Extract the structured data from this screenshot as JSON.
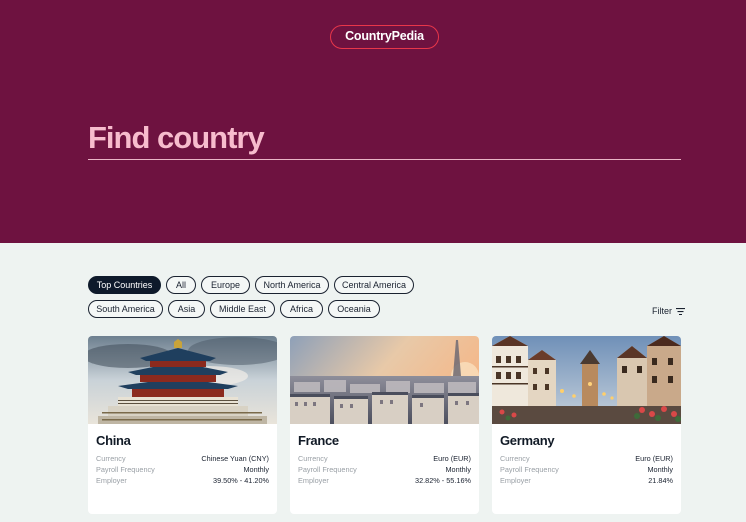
{
  "header": {
    "logo": "CountryPedia",
    "search_placeholder": "Find country"
  },
  "filters": {
    "chips": [
      "Top Countries",
      "All",
      "Europe",
      "North America",
      "Central America",
      "South America",
      "Asia",
      "Middle East",
      "Africa",
      "Oceania"
    ],
    "active": "Top Countries",
    "filter_label": "Filter"
  },
  "labels": {
    "currency": "Currency",
    "payroll": "Payroll Frequency",
    "employer": "Employer"
  },
  "cards": [
    {
      "name": "China",
      "currency": "Chinese Yuan (CNY)",
      "payroll_frequency": "Monthly",
      "employer": "39.50% - 41.20%",
      "image": "temple-of-heaven-photo"
    },
    {
      "name": "France",
      "currency": "Euro (EUR)",
      "payroll_frequency": "Monthly",
      "employer": "32.82% - 55.16%",
      "image": "paris-skyline-photo"
    },
    {
      "name": "Germany",
      "currency": "Euro (EUR)",
      "payroll_frequency": "Monthly",
      "employer": "21.84%",
      "image": "german-old-town-street-photo"
    }
  ],
  "colors": {
    "hero_bg": "#6e1240",
    "accent": "#e8364a",
    "search_text": "#f7bccd",
    "page_bg": "#eef3f1",
    "chip_active": "#0e1a2b"
  }
}
